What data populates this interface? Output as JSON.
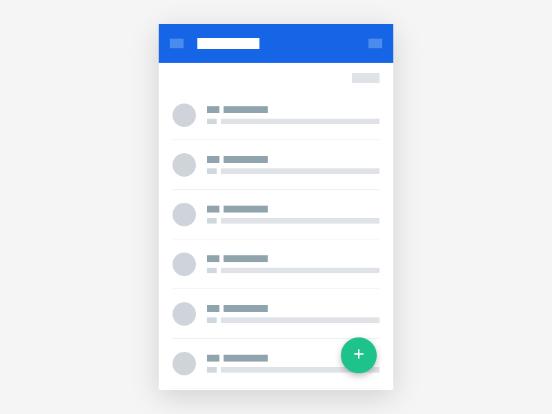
{
  "colors": {
    "appbar": "#1565e6",
    "fab": "#1ec28b",
    "avatar": "#ced4da",
    "skeleton_dark": "#90a4ae",
    "skeleton_light": "#dfe3e8"
  },
  "appbar": {
    "title": "",
    "nav_icon": "menu-icon",
    "action_icon": "more-icon"
  },
  "section": {
    "label": ""
  },
  "list_items": [
    {
      "primary": "",
      "secondary": ""
    },
    {
      "primary": "",
      "secondary": ""
    },
    {
      "primary": "",
      "secondary": ""
    },
    {
      "primary": "",
      "secondary": ""
    },
    {
      "primary": "",
      "secondary": ""
    },
    {
      "primary": "",
      "secondary": ""
    }
  ],
  "fab": {
    "icon": "plus-icon",
    "label": "+"
  }
}
